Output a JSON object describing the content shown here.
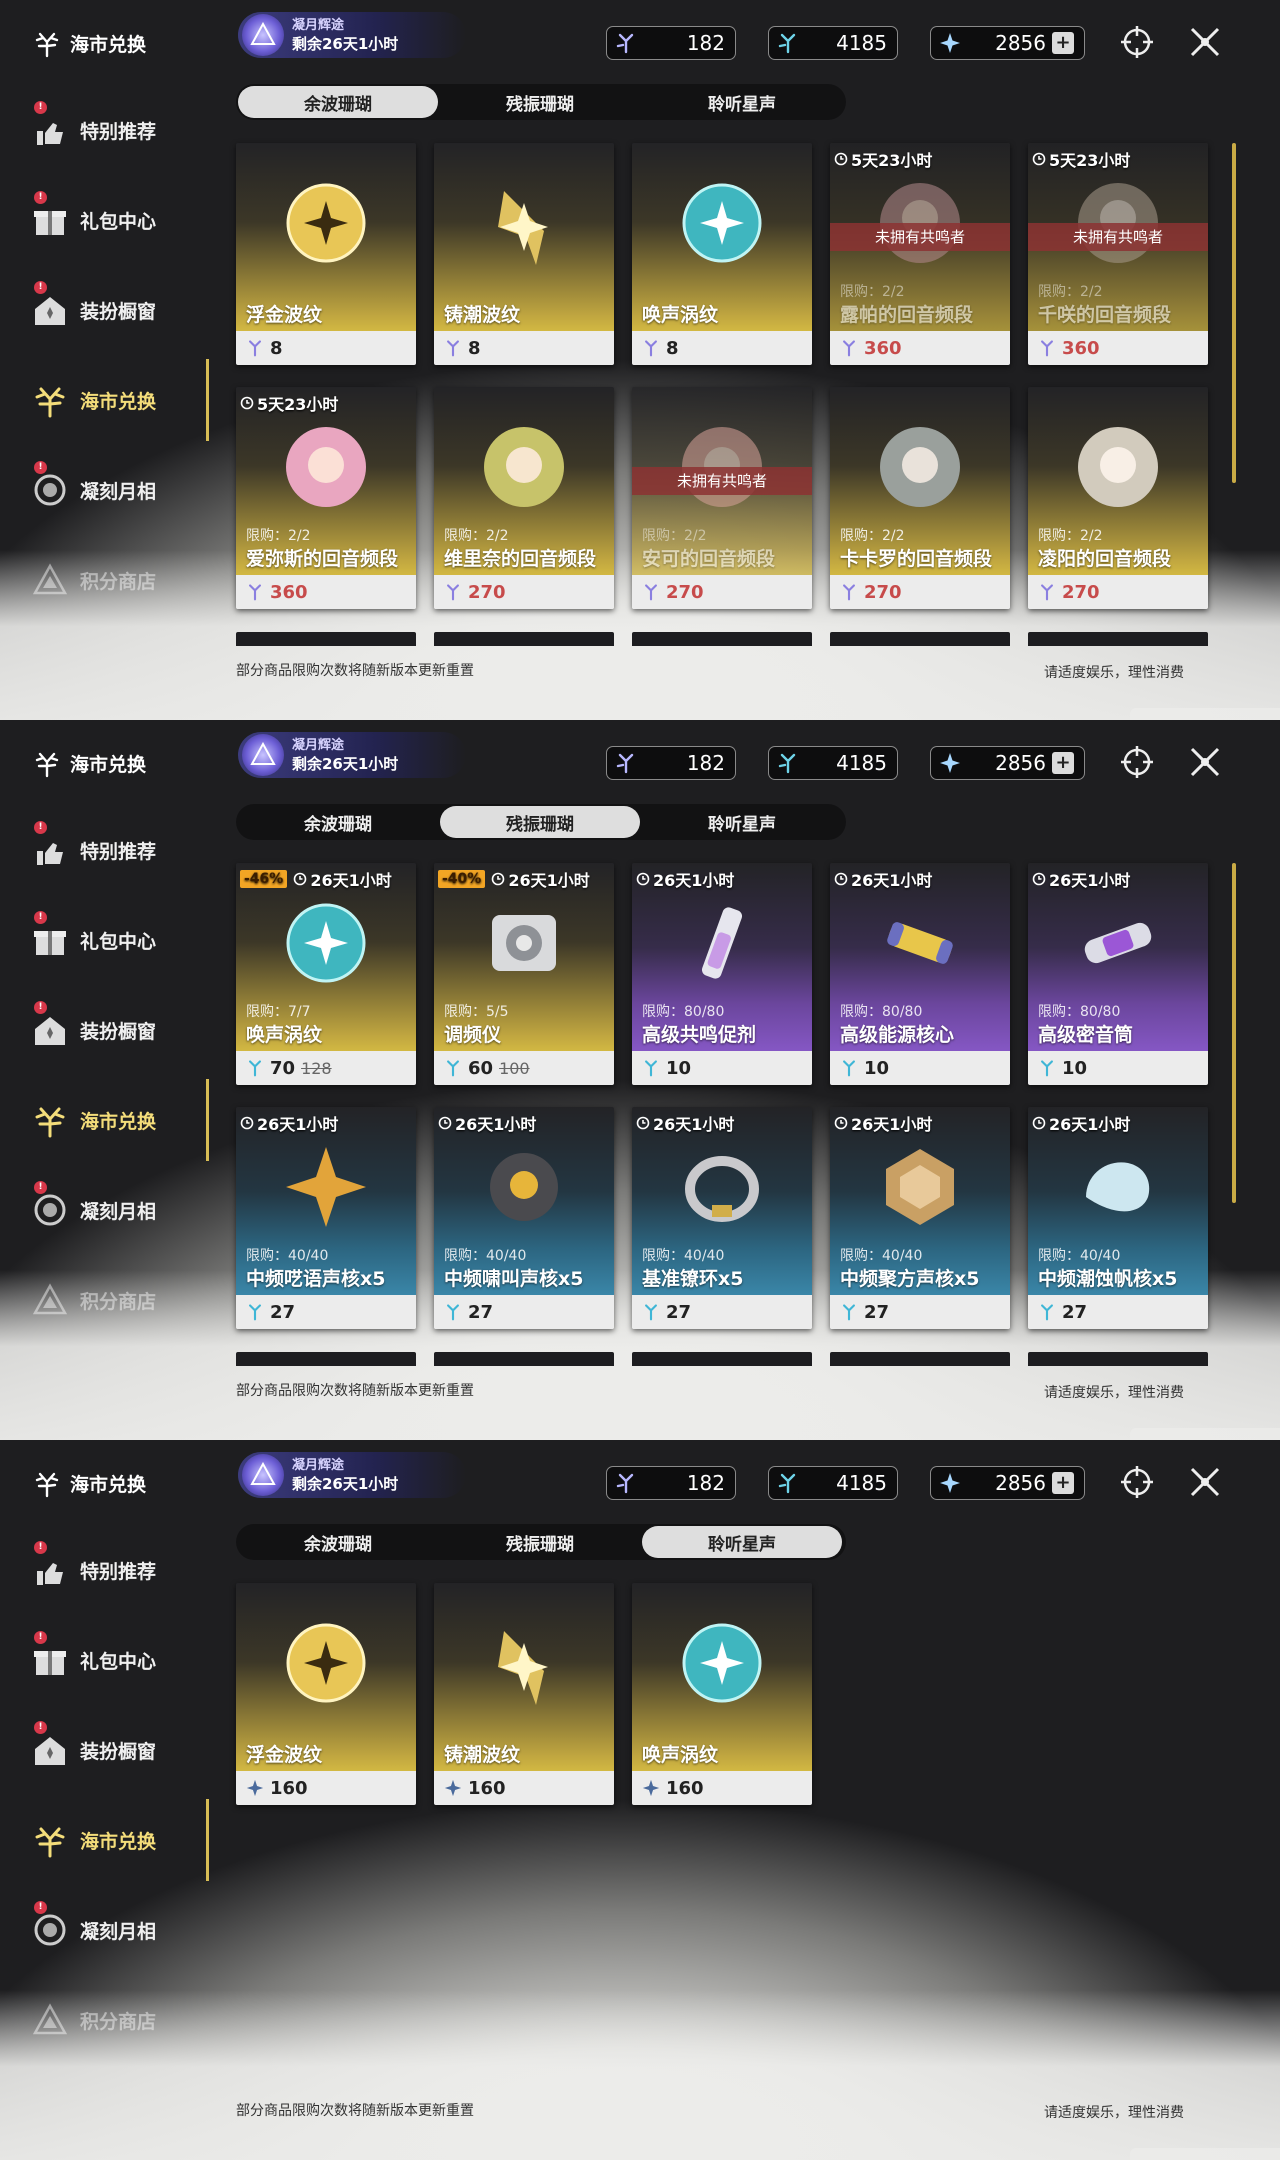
{
  "sidebar": {
    "brand": "海市兑换",
    "items": [
      {
        "label": "特别推荐",
        "badge": "!"
      },
      {
        "label": "礼包中心",
        "badge": "!"
      },
      {
        "label": "装扮橱窗",
        "badge": "!"
      },
      {
        "label": "海市兑换",
        "badge": ""
      },
      {
        "label": "凝刻月相",
        "badge": "!"
      },
      {
        "label": "积分商店",
        "badge": ""
      }
    ]
  },
  "event": {
    "title": "凝月辉途",
    "remain_first": "剩余26天1小时"
  },
  "currency": {
    "a": "182",
    "b": "4185",
    "c": "2856",
    "plus": "+"
  },
  "tabs": [
    "余波珊瑚",
    "残振珊瑚",
    "聆听星声"
  ],
  "notice": "部分商品限购次数将随新版本更新重置",
  "health": "请适度娱乐，理性消费",
  "panel1": {
    "cards": [
      {
        "name": "浮金波纹",
        "price": "8",
        "limit": "",
        "timer": "",
        "banner": ""
      },
      {
        "name": "铸潮波纹",
        "price": "8",
        "limit": "",
        "timer": "",
        "banner": ""
      },
      {
        "name": "唤声涡纹",
        "price": "8",
        "limit": "",
        "timer": "",
        "banner": ""
      },
      {
        "name": "露帕的回音频段",
        "price": "360",
        "limit": "限购：2/2",
        "timer": "5天23小时",
        "banner": "未拥有共鸣者"
      },
      {
        "name": "千咲的回音频段",
        "price": "360",
        "limit": "限购：2/2",
        "timer": "5天23小时",
        "banner": "未拥有共鸣者"
      },
      {
        "name": "爱弥斯的回音频段",
        "price": "360",
        "limit": "限购：2/2",
        "timer": "5天23小时",
        "banner": ""
      },
      {
        "name": "维里奈的回音频段",
        "price": "270",
        "limit": "限购：2/2",
        "timer": "",
        "banner": ""
      },
      {
        "name": "安可的回音频段",
        "price": "270",
        "limit": "限购：2/2",
        "timer": "",
        "banner": "未拥有共鸣者"
      },
      {
        "name": "卡卡罗的回音频段",
        "price": "270",
        "limit": "限购：2/2",
        "timer": "",
        "banner": ""
      },
      {
        "name": "凌阳的回音频段",
        "price": "270",
        "limit": "限购：2/2",
        "timer": "",
        "banner": ""
      }
    ]
  },
  "panel2": {
    "cards": [
      {
        "name": "唤声涡纹",
        "price": "70",
        "old": "128",
        "disc": "-46%",
        "limit": "限购：7/7",
        "timer": "26天1小时"
      },
      {
        "name": "调频仪",
        "price": "60",
        "old": "100",
        "disc": "-40%",
        "limit": "限购：5/5",
        "timer": "26天1小时"
      },
      {
        "name": "高级共鸣促剂",
        "price": "10",
        "old": "",
        "disc": "",
        "limit": "限购：80/80",
        "timer": "26天1小时"
      },
      {
        "name": "高级能源核心",
        "price": "10",
        "old": "",
        "disc": "",
        "limit": "限购：80/80",
        "timer": "26天1小时"
      },
      {
        "name": "高级密音筒",
        "price": "10",
        "old": "",
        "disc": "",
        "limit": "限购：80/80",
        "timer": "26天1小时"
      },
      {
        "name": "中频呓语声核x5",
        "price": "27",
        "old": "",
        "disc": "",
        "limit": "限购：40/40",
        "timer": "26天1小时"
      },
      {
        "name": "中频啸叫声核x5",
        "price": "27",
        "old": "",
        "disc": "",
        "limit": "限购：40/40",
        "timer": "26天1小时"
      },
      {
        "name": "基准镣环x5",
        "price": "27",
        "old": "",
        "disc": "",
        "limit": "限购：40/40",
        "timer": "26天1小时"
      },
      {
        "name": "中频聚方声核x5",
        "price": "27",
        "old": "",
        "disc": "",
        "limit": "限购：40/40",
        "timer": "26天1小时"
      },
      {
        "name": "中频潮蚀帆核x5",
        "price": "27",
        "old": "",
        "disc": "",
        "limit": "限购：40/40",
        "timer": "26天1小时"
      }
    ]
  },
  "panel3": {
    "cards": [
      {
        "name": "浮金波纹",
        "price": "160"
      },
      {
        "name": "铸潮波纹",
        "price": "160"
      },
      {
        "name": "唤声涡纹",
        "price": "160"
      }
    ]
  },
  "colors": {
    "gold": "#d2b842",
    "purple": "#8557c4",
    "blue": "#3a86a8",
    "active": "#f4dd7a",
    "price_red": "#c74b4b"
  }
}
